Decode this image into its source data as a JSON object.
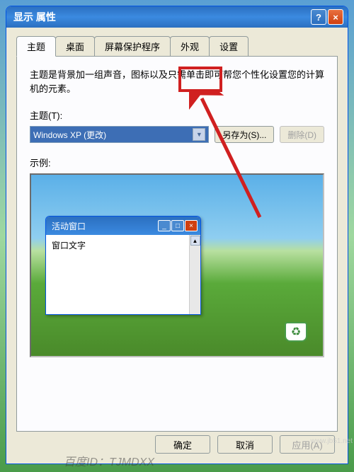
{
  "window": {
    "title": "显示 属性",
    "help": "?",
    "close": "×"
  },
  "tabs": [
    "主题",
    "桌面",
    "屏幕保护程序",
    "外观",
    "设置"
  ],
  "description": "主题是背景加一组声音，图标以及只需单击即可帮您个性化设置您的计算机的元素。",
  "theme_label": "主题(T):",
  "theme_value": "Windows XP (更改)",
  "dropdown_arrow": "▼",
  "save_as_btn": "另存为(S)...",
  "delete_btn": "删除(D)",
  "preview_label": "示例:",
  "inner_window": {
    "title": "活动窗口",
    "body_text": "窗口文字",
    "min": "_",
    "max": "□",
    "close": "×"
  },
  "buttons": {
    "ok": "确定",
    "cancel": "取消",
    "apply": "应用(A)"
  },
  "watermark_left": "百度ID：TJMDXX",
  "watermark_right": "www.jb51.net",
  "recycle_icon": "♻"
}
